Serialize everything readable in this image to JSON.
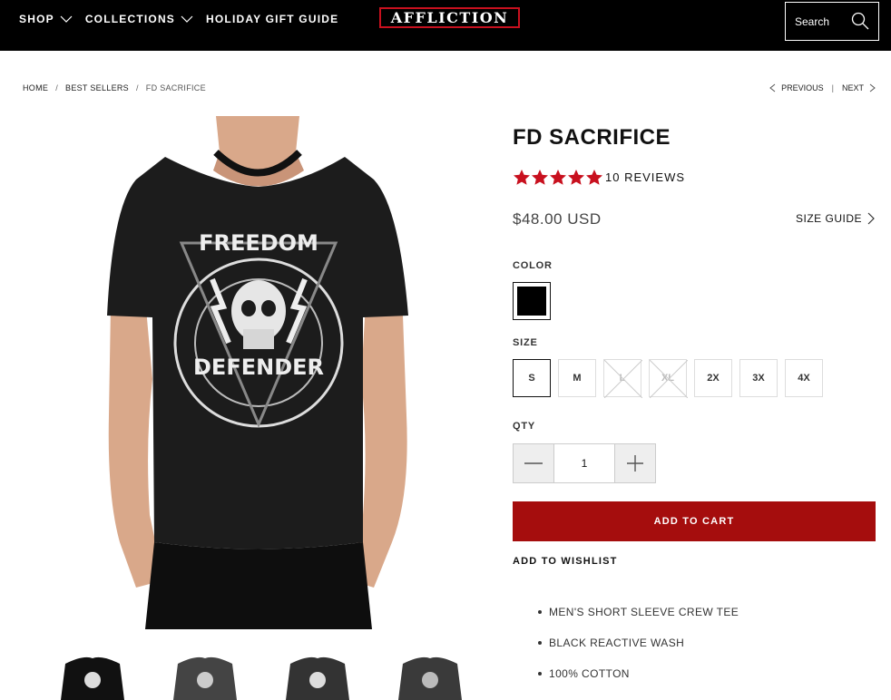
{
  "header": {
    "nav": [
      {
        "label": "SHOP",
        "has_dropdown": true
      },
      {
        "label": "COLLECTIONS",
        "has_dropdown": true
      },
      {
        "label": "HOLIDAY GIFT GUIDE",
        "has_dropdown": false
      }
    ],
    "logo": "AFFLICTION",
    "search_placeholder": "Search"
  },
  "breadcrumb": {
    "items": [
      "HOME",
      "BEST SELLERS",
      "FD SACRIFICE"
    ],
    "separator": "/"
  },
  "pager": {
    "previous": "PREVIOUS",
    "next": "NEXT",
    "separator": "|"
  },
  "product": {
    "title": "FD SACRIFICE",
    "rating": 5,
    "reviews": "10 REVIEWS",
    "price": "$48.00 USD",
    "size_guide": "SIZE GUIDE",
    "color_label": "COLOR",
    "size_label": "SIZE",
    "sizes": [
      {
        "label": "S",
        "selected": true,
        "available": true
      },
      {
        "label": "M",
        "selected": false,
        "available": true
      },
      {
        "label": "L",
        "selected": false,
        "available": false
      },
      {
        "label": "XL",
        "selected": false,
        "available": false
      },
      {
        "label": "2X",
        "selected": false,
        "available": true
      },
      {
        "label": "3X",
        "selected": false,
        "available": true
      },
      {
        "label": "4X",
        "selected": false,
        "available": true
      }
    ],
    "qty_label": "QTY",
    "qty": "1",
    "add_to_cart": "ADD TO CART",
    "wishlist": "ADD TO WISHLIST",
    "features": [
      "MEN'S SHORT SLEEVE CREW TEE",
      "BLACK REACTIVE WASH",
      "100% COTTON"
    ],
    "shirt_graphic_top": "FREEDOM",
    "shirt_graphic_bottom": "DEFENDER"
  },
  "colors": {
    "accent": "#a50d0d",
    "star": "#c8101e",
    "header_bg": "#000000"
  }
}
